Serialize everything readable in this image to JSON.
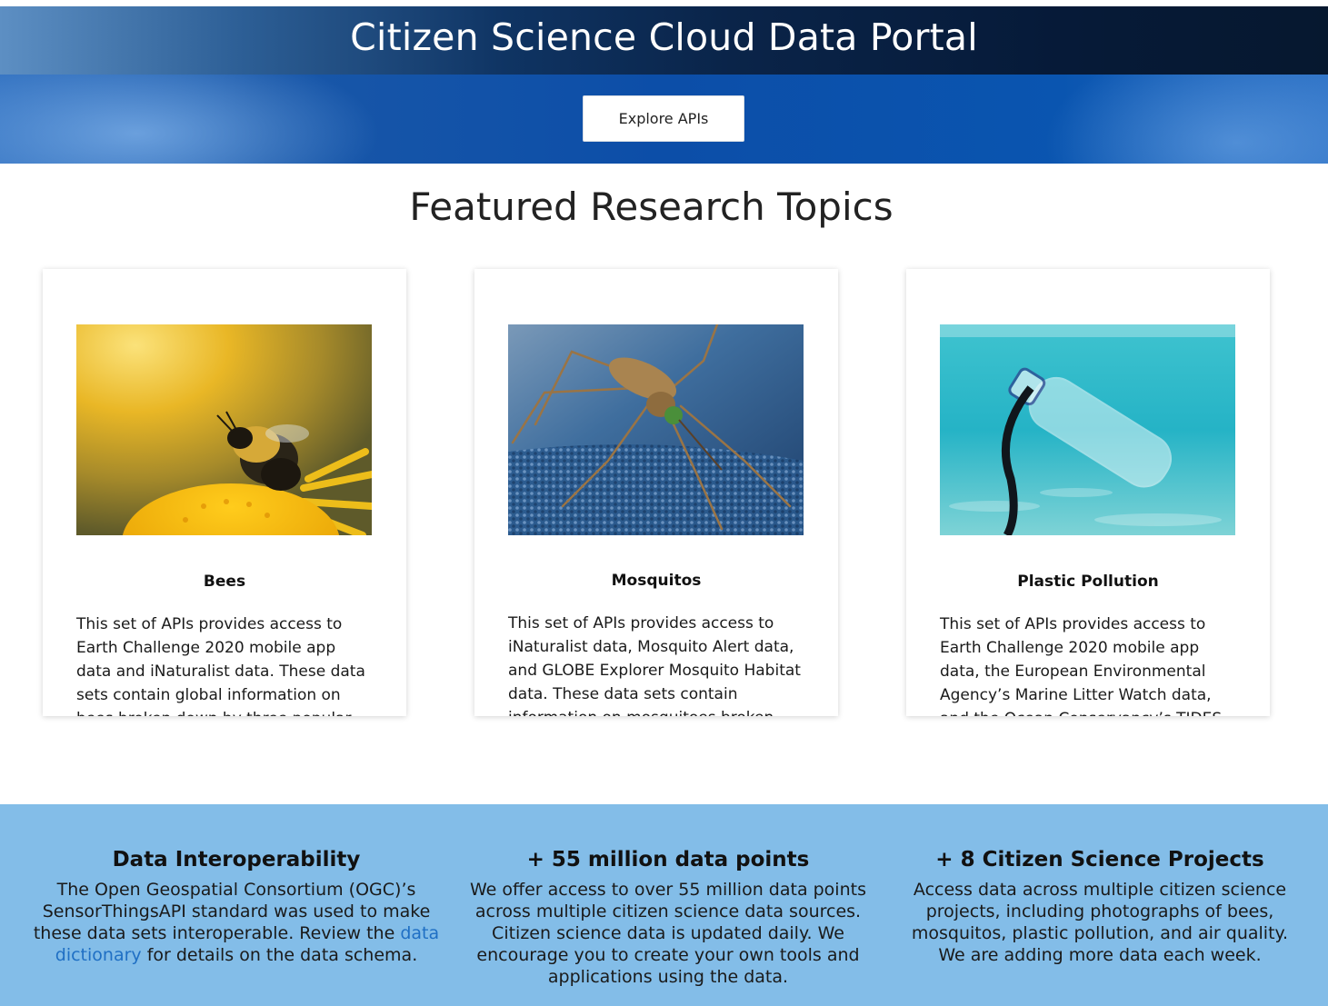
{
  "header": {
    "title": "Citizen Science Cloud Data Portal",
    "explore_label": "Explore APIs"
  },
  "featured": {
    "title": "Featured Research Topics",
    "cards": [
      {
        "title": "Bees",
        "image_icon": "bee-on-flower-photo",
        "text": "This set of APIs provides access to Earth Challenge 2020 mobile app data and iNaturalist data.  These data sets contain global information on bees broken down by three popular genera"
      },
      {
        "title": "Mosquitos",
        "image_icon": "mosquito-photo",
        "text": "This set of APIs provides access to iNaturalist data, Mosquito Alert data, and GLOBE Explorer Mosquito Habitat data.  These data sets contain information on mosquitoes broken"
      },
      {
        "title": "Plastic Pollution",
        "image_icon": "plastic-bottle-underwater-photo",
        "text": "This set of APIs provides access to Earth Challenge 2020 mobile app data, the European Environmental Agency’s Marine Litter Watch data, and the Ocean Conservancy’s TIDES data"
      }
    ]
  },
  "stats": [
    {
      "title": "Data Interoperability",
      "text_before": "The Open Geospatial Consortium (OGC)’s SensorThingsAPI standard was used to make these data sets interoperable.  Review the ",
      "link": "data dictionary",
      "text_after": " for details on the data schema."
    },
    {
      "title": "+ 55 million data points",
      "text": "We offer access to over 55 million data points across multiple citizen science data sources.  Citizen science data is updated daily.  We encourage you to create your own tools and applications using the data."
    },
    {
      "title": "+ 8 Citizen Science Projects",
      "text": "Access data across multiple citizen science projects, including photographs of bees, mosquitos, plastic pollution, and air quality.  We are adding more data each week."
    }
  ],
  "colors": {
    "banner_blue": "#0c4ea8",
    "stats_background": "#83bde8",
    "link": "#1f6fc4"
  }
}
